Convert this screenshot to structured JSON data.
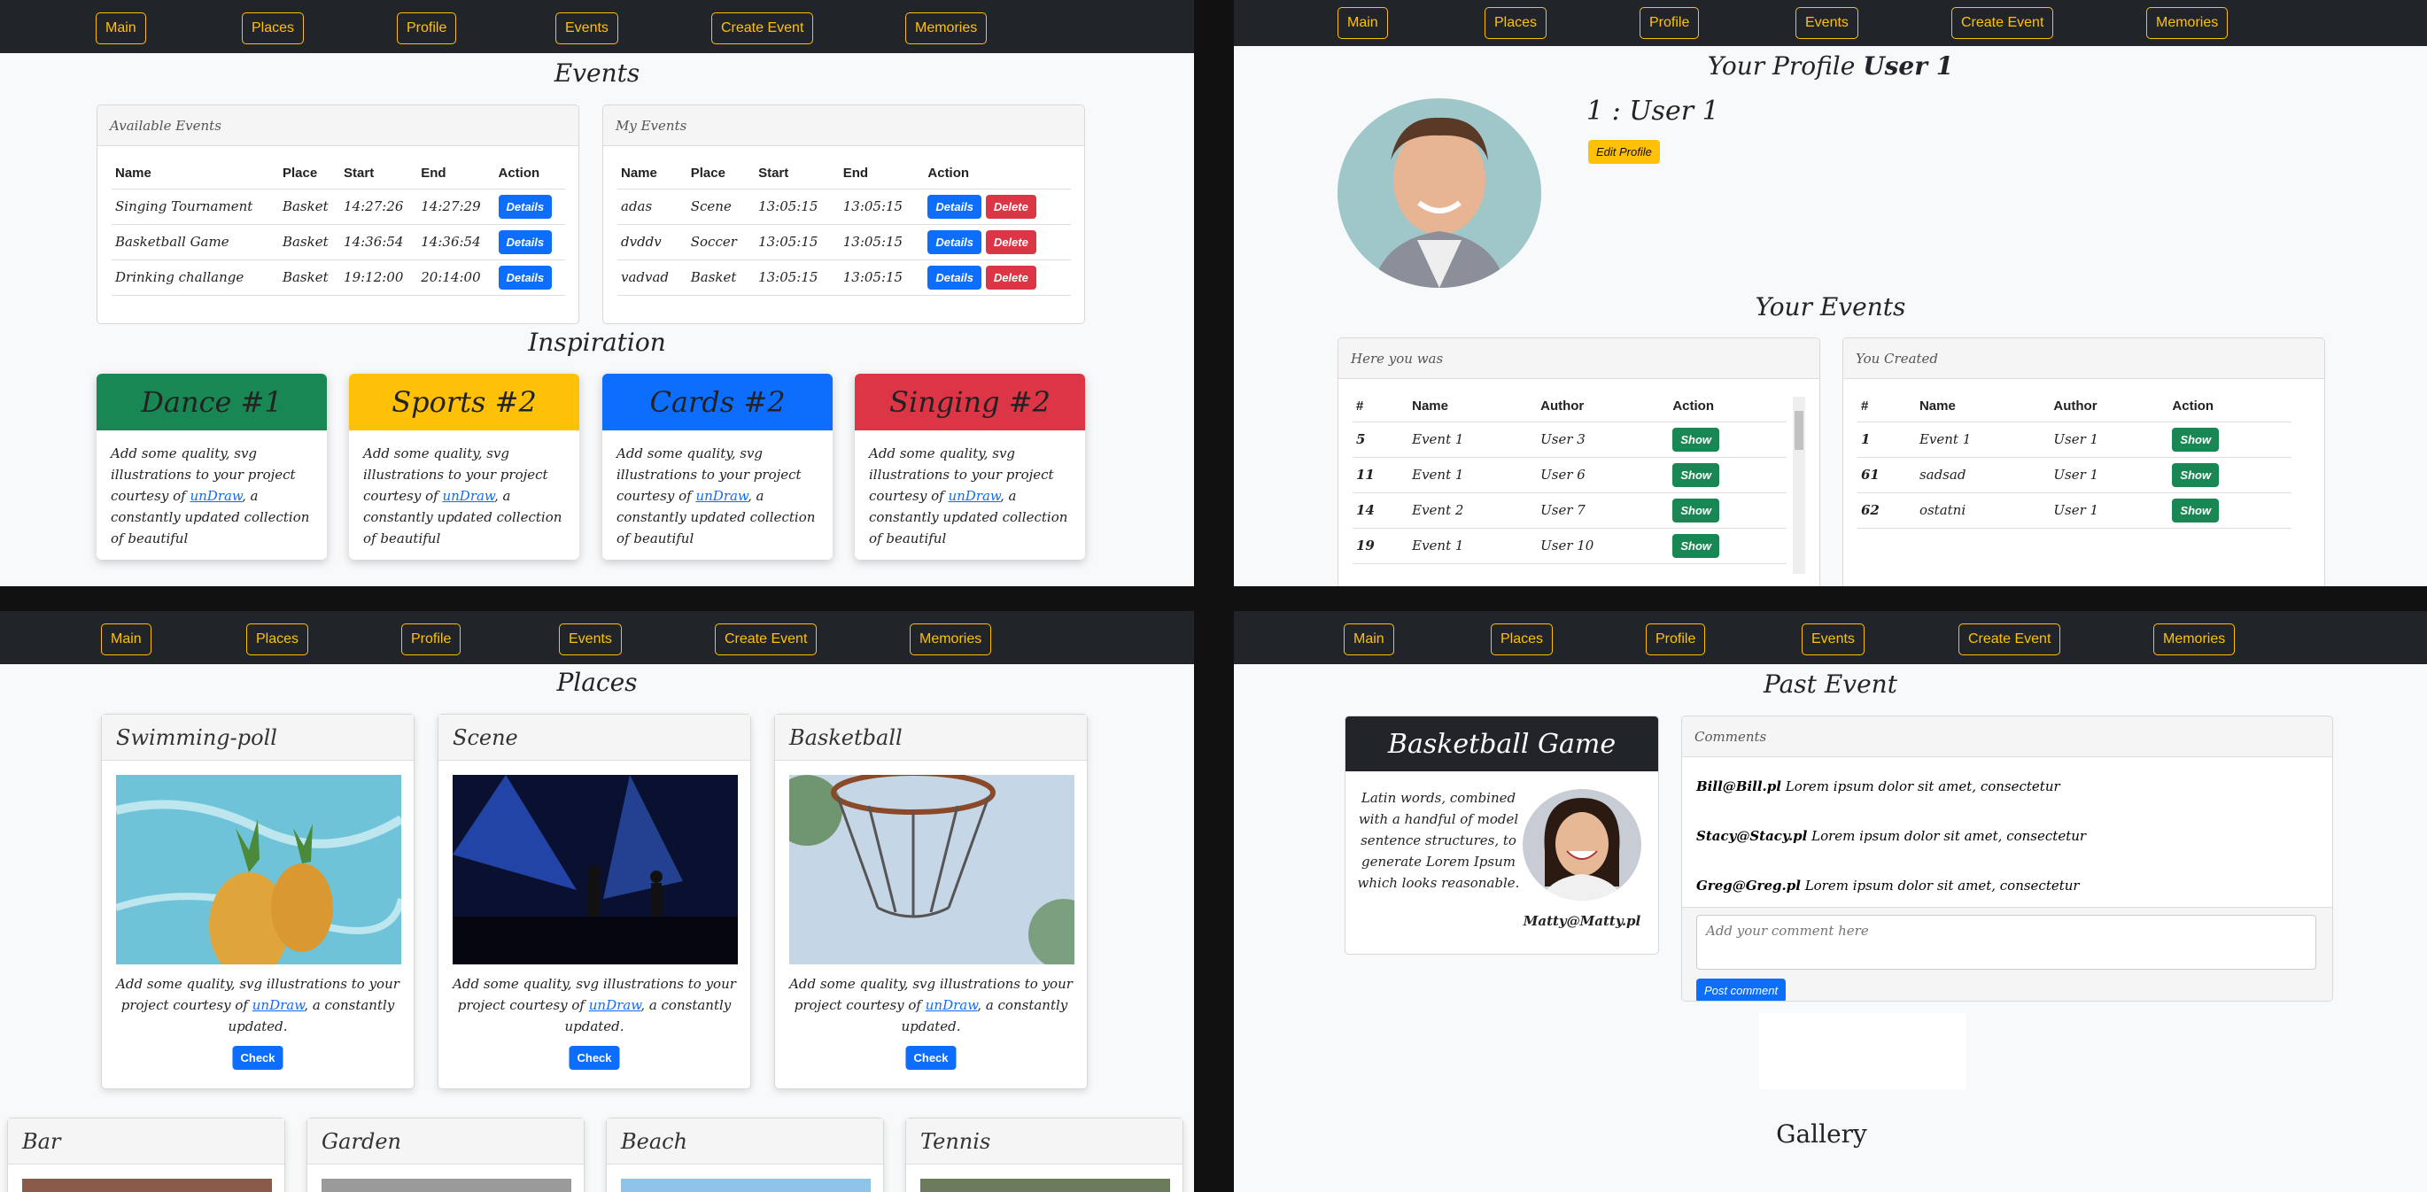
{
  "nav": [
    "Main",
    "Places",
    "Profile",
    "Events",
    "Create Event",
    "Memories"
  ],
  "events": {
    "title": "Events",
    "available": {
      "title": "Available Events",
      "headers": [
        "Name",
        "Place",
        "Start",
        "End",
        "Action"
      ],
      "rows": [
        [
          "Singing Tournament",
          "Basket",
          "14:27:26",
          "14:27:29"
        ],
        [
          "Basketball Game",
          "Basket",
          "14:36:54",
          "14:36:54"
        ],
        [
          "Drinking challange",
          "Basket",
          "19:12:00",
          "20:14:00"
        ]
      ]
    },
    "mine": {
      "title": "My Events",
      "headers": [
        "Name",
        "Place",
        "Start",
        "End",
        "Action"
      ],
      "rows": [
        [
          "adas",
          "Scene",
          "13:05:15",
          "13:05:15"
        ],
        [
          "dvddv",
          "Soccer",
          "13:05:15",
          "13:05:15"
        ],
        [
          "vadvad",
          "Basket",
          "13:05:15",
          "13:05:15"
        ]
      ]
    },
    "details": "Details",
    "delete": "Delete",
    "inspiration": "Inspiration",
    "cards": [
      {
        "title": "Dance #1",
        "color": "#198754"
      },
      {
        "title": "Sports #2",
        "color": "#ffc107"
      },
      {
        "title": "Cards #2",
        "color": "#0d6efd"
      },
      {
        "title": "Singing #2",
        "color": "#dc3545"
      }
    ],
    "card_text_a": "Add some quality, svg illustrations to your project courtesy of ",
    "card_link": "unDraw",
    "card_text_b": ", a constantly updated collection of beautiful"
  },
  "profile": {
    "title_a": "Your Profile ",
    "title_b": "User 1",
    "name": "1 : User 1",
    "edit": "Edit Profile",
    "your_events": "Your Events",
    "was": {
      "title": "Here you was",
      "headers": [
        "#",
        "Name",
        "Author",
        "Action"
      ],
      "rows": [
        [
          "5",
          "Event 1",
          "User 3"
        ],
        [
          "11",
          "Event 1",
          "User 6"
        ],
        [
          "14",
          "Event 2",
          "User 7"
        ],
        [
          "19",
          "Event 1",
          "User 10"
        ]
      ]
    },
    "created": {
      "title": "You Created",
      "headers": [
        "#",
        "Name",
        "Author",
        "Action"
      ],
      "rows": [
        [
          "1",
          "Event 1",
          "User 1"
        ],
        [
          "61",
          "sadsad",
          "User 1"
        ],
        [
          "62",
          "ostatni",
          "User 1"
        ]
      ]
    },
    "show": "Show"
  },
  "places": {
    "title": "Places",
    "items": [
      {
        "name": "Swimming-poll"
      },
      {
        "name": "Scene"
      },
      {
        "name": "Basketball"
      }
    ],
    "text_a": "Add some quality, svg illustrations to your project courtesy of ",
    "link": "unDraw",
    "text_b": ", a constantly updated.",
    "check": "Check",
    "more": [
      "Bar",
      "Garden",
      "Beach",
      "Tennis"
    ]
  },
  "past": {
    "title": "Past Event",
    "event": "Basketball Game",
    "desc": "Latin words, combined with a handful of model sentence structures, to generate Lorem Ipsum which looks reasonable.",
    "author": "Matty@Matty.pl",
    "comments_title": "Comments",
    "comments": [
      {
        "user": "Bill@Bill.pl",
        "text": "Lorem ipsum dolor sit amet, consectetur"
      },
      {
        "user": "Stacy@Stacy.pl",
        "text": "Lorem ipsum dolor sit amet, consectetur"
      },
      {
        "user": "Greg@Greg.pl",
        "text": "Lorem ipsum dolor sit amet, consectetur"
      }
    ],
    "placeholder": "Add your comment here",
    "post": "Post comment",
    "gallery": "Gallery"
  }
}
